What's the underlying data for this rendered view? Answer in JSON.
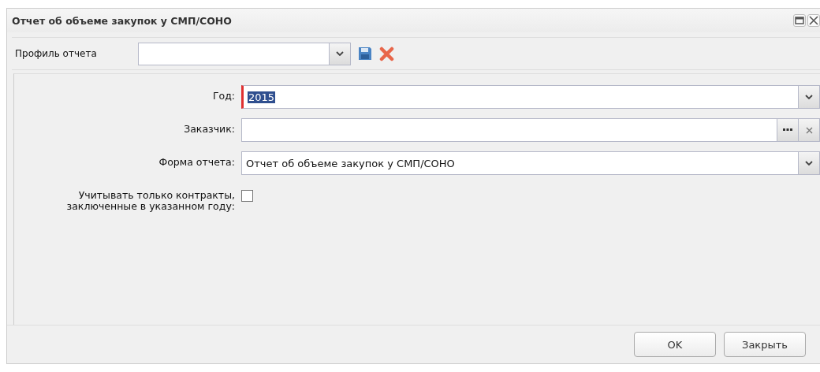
{
  "window": {
    "title": "Отчет об объеме закупок у СМП/СОНО"
  },
  "toolbar": {
    "label": "Профиль отчета"
  },
  "fields": [
    {
      "kind": "combo",
      "label": "Год:",
      "value": "2015",
      "required": true,
      "highlighted": true
    },
    {
      "kind": "lookup",
      "label": "Заказчик:",
      "required": false
    },
    {
      "kind": "combo",
      "label": "Форма отчета:",
      "value": "Отчет об объеме закупок у СМП/СОНО",
      "required": false,
      "highlighted": false
    },
    {
      "kind": "checkbox",
      "label": "Учитывать только контракты, заключенные в указанном году:",
      "checked": false
    }
  ],
  "buttons": [
    "OK",
    "Закрыть"
  ]
}
